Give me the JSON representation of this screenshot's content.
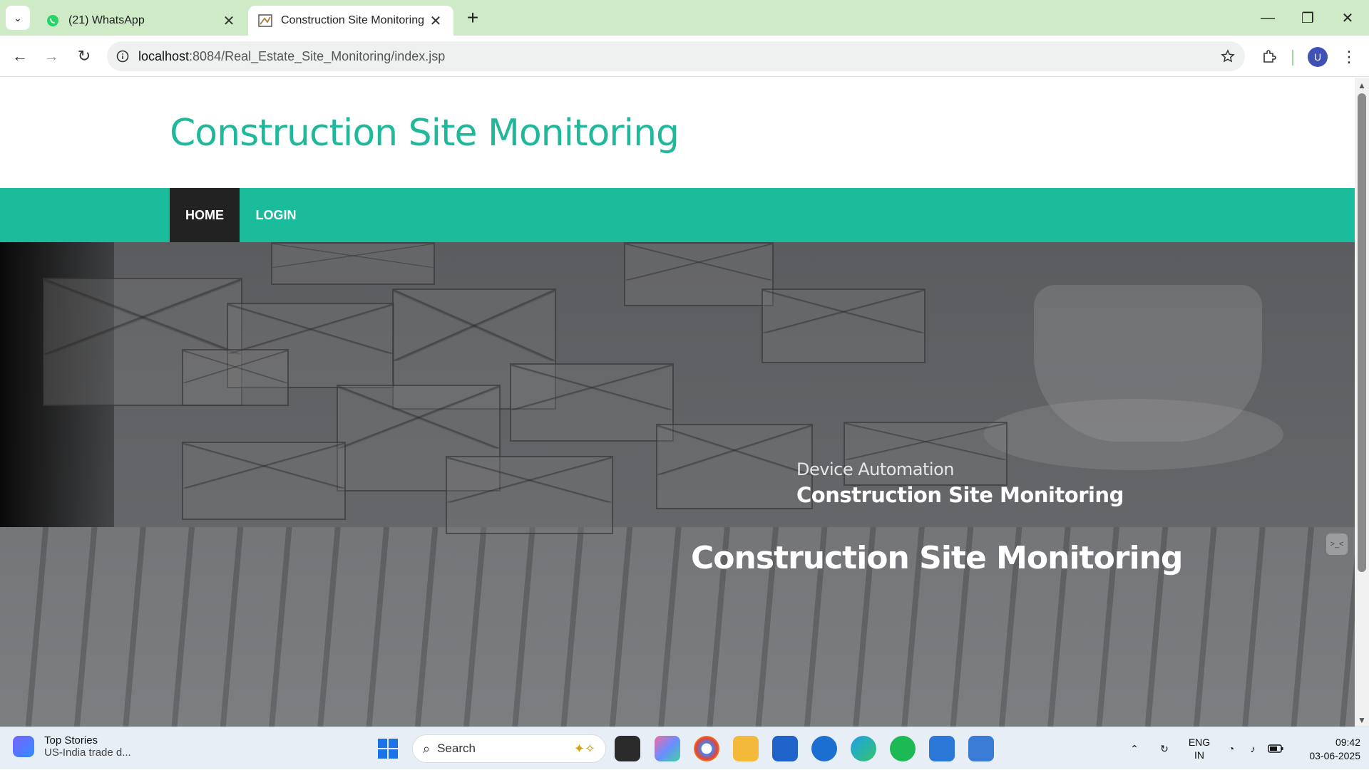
{
  "browser": {
    "tabs": [
      {
        "title": "(21) WhatsApp",
        "active": false,
        "icon": "whatsapp-icon"
      },
      {
        "title": "Construction Site Monitoring",
        "active": true,
        "icon": "site-favicon"
      }
    ],
    "url_host": "localhost",
    "url_path": ":8084/Real_Estate_Site_Monitoring/index.jsp",
    "profile_initial": "U"
  },
  "site": {
    "title": "Construction Site Monitoring",
    "nav": [
      {
        "label": "HOME",
        "active": true
      },
      {
        "label": "LOGIN",
        "active": false
      }
    ]
  },
  "hero": {
    "subtitle": "Device Automation",
    "subtitle2": "Construction Site Monitoring",
    "title": "Construction Site Monitoring",
    "widget_text": ">_<"
  },
  "taskbar": {
    "news_title": "Top Stories",
    "news_text": "US-India trade d...",
    "search_placeholder": "Search",
    "lang1": "ENG",
    "lang2": "IN",
    "time": "09:42",
    "date": "03-06-2025"
  },
  "colors": {
    "accent": "#1abc9c",
    "title": "#1fb89a",
    "nav_active": "#222222",
    "tabbar": "#cfeac7"
  }
}
